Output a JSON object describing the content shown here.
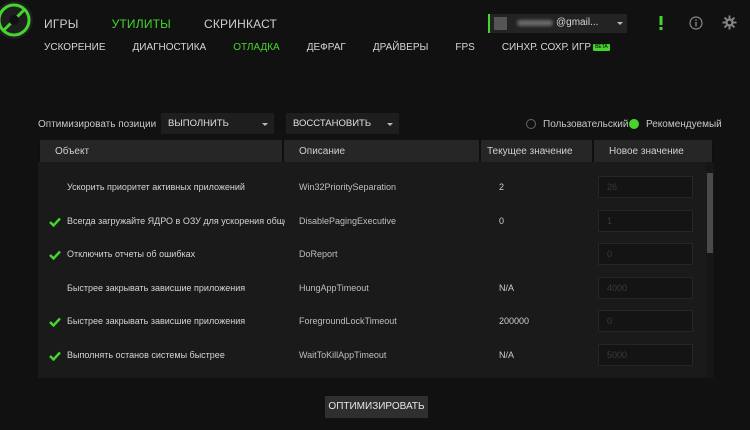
{
  "nav": {
    "top": [
      {
        "label": "ИГРЫ",
        "active": false
      },
      {
        "label": "УТИЛИТЫ",
        "active": true
      },
      {
        "label": "СКРИНКАСТ",
        "active": false
      }
    ],
    "sub": [
      {
        "label": "УСКОРЕНИЕ",
        "active": false
      },
      {
        "label": "ДИАГНОСТИКА",
        "active": false
      },
      {
        "label": "ОТЛАДКА",
        "active": true
      },
      {
        "label": "ДЕФРАГ",
        "active": false
      },
      {
        "label": "ДРАЙВЕРЫ",
        "active": false
      },
      {
        "label": "FPS",
        "active": false
      },
      {
        "label": "СИНХР. СОХР. ИГР",
        "active": false
      }
    ],
    "beta_badge": "BETA"
  },
  "account": {
    "email_suffix": "@gmail..."
  },
  "icons": {
    "alert": "exclamation-icon",
    "info": "info-icon",
    "settings": "gear-icon"
  },
  "controls": {
    "optimize_label": "Оптимизировать позиции",
    "execute": "ВЫПОЛНИТЬ",
    "restore": "ВОССТАНОВИТЬ",
    "mode_custom": "Пользовательский",
    "mode_recommended": "Рекомендуемый",
    "mode_selected": "recommended"
  },
  "table": {
    "headers": {
      "object": "Объект",
      "description": "Описание",
      "current": "Текущее значение",
      "new": "Новое значение"
    },
    "rows": [
      {
        "checked": false,
        "object": "Ускорить приоритет активных приложений",
        "description": "Win32PrioritySeparation",
        "current": "2",
        "new": "26"
      },
      {
        "checked": true,
        "object": "Всегда загружайте ЯДРО в ОЗУ для ускорения общей прои",
        "description": "DisablePagingExecutive",
        "current": "0",
        "new": "1"
      },
      {
        "checked": true,
        "object": "Отключить отчеты об ошибках",
        "description": "DoReport",
        "current": "",
        "new": "0"
      },
      {
        "checked": false,
        "object": "Быстрее закрывать зависшие приложения",
        "description": "HungAppTimeout",
        "current": "N/A",
        "new": "4000"
      },
      {
        "checked": true,
        "object": "Быстрее закрывать зависшие приложения",
        "description": "ForegroundLockTimeout",
        "current": "200000",
        "new": "0"
      },
      {
        "checked": true,
        "object": "Выполнять останов системы быстрее",
        "description": "WaitToKillAppTimeout",
        "current": "N/A",
        "new": "5000"
      }
    ]
  },
  "optimize_button": "ОПТИМИЗИРОВАТЬ",
  "colors": {
    "accent": "#44d62c",
    "background": "#111111",
    "panel": "#1a1a1a"
  }
}
